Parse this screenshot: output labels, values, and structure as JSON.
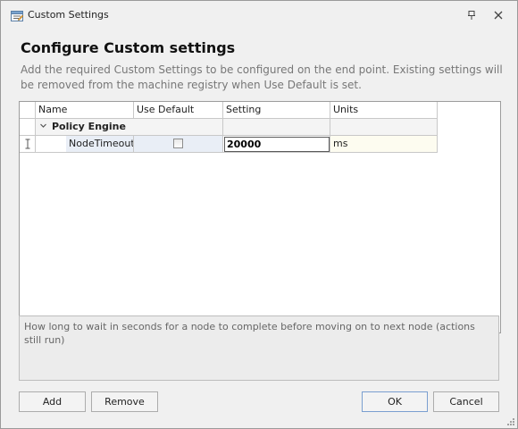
{
  "window": {
    "title": "Custom Settings"
  },
  "heading": "Configure Custom settings",
  "description": "Add the required Custom Settings to be configured on the end point. Existing settings will be removed from the machine registry when Use Default is set.",
  "grid": {
    "columns": [
      "Name",
      "Use Default",
      "Setting",
      "Units"
    ],
    "groups": [
      {
        "label": "Policy Engine",
        "expanded": true,
        "rows": [
          {
            "name": "NodeTimeout",
            "use_default": false,
            "setting": "20000",
            "units": "ms"
          }
        ]
      }
    ]
  },
  "help_text": "How long to wait in seconds for a node to complete before moving on to next node (actions still run)",
  "buttons": {
    "add": "Add",
    "remove": "Remove",
    "ok": "OK",
    "cancel": "Cancel"
  },
  "icons": {
    "app": "settings-window-icon",
    "pin": "pin-icon",
    "close": "close-icon",
    "expand": "chevron-down-icon",
    "edit_row": "text-cursor-icon"
  }
}
